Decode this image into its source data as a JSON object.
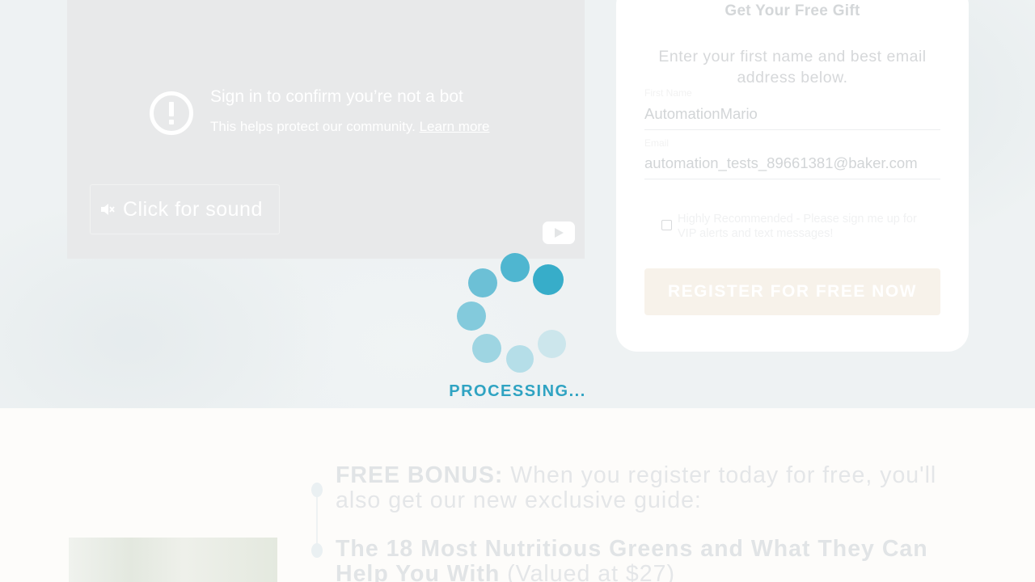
{
  "video": {
    "bot_title": "Sign in to confirm you’re not a bot",
    "bot_subtitle": "This helps protect our community.",
    "learn_more": "Learn more",
    "sound_label": "Click for sound",
    "icons": [
      "alert-circle-icon",
      "speaker-muted-icon",
      "youtube-play-icon"
    ]
  },
  "form": {
    "title": "Get Your Free Gift",
    "description": "Enter your first name and best email address below.",
    "first_name_label": "First Name",
    "first_name_value": "AutomationMario",
    "email_label": "Email",
    "email_value": "automation_tests_89661381@baker.com",
    "vip_label": "Highly Recommended - Please sign me up for VIP alerts and text messages!",
    "submit_label": "REGISTER FOR FREE NOW"
  },
  "spinner": {
    "label": "PROCESSING...",
    "color": "#2fa3c2"
  },
  "bonus": {
    "lead_bold": "FREE BONUS:",
    "lead_text": " When you register today for free, you'll also get our new exclusive guide:",
    "title_bold": "The 18 Most Nutritious Greens and What They Can Help You With",
    "title_value": " (Valued at $27)"
  },
  "colors": {
    "accent": "#2fa3c2",
    "hero_bg": "#eef2f3",
    "button_bg": "#f7f2ea"
  }
}
